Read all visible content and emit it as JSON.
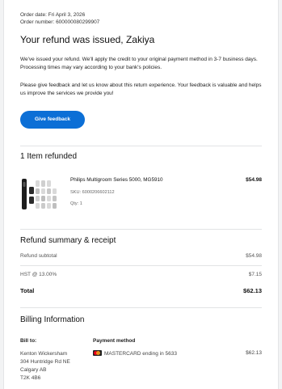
{
  "order": {
    "date_line": "Order date: Fri April 3, 2026",
    "number_line": "Order number: 600000080299907"
  },
  "title": "Your refund was issued, Zakiya",
  "message": {
    "p1": "We've issued your refund. We'll apply the credit to your original payment method in 3-7 business days. Processing times may vary according to your bank's policies.",
    "p2": "Please give feedback and let us know about this return experience. Your feedback is valuable and helps us improve the services we provide you!"
  },
  "feedback_button": "Give feedback",
  "items_section": {
    "title": "1 Item refunded",
    "items": [
      {
        "name": "Philips Multigroom Series 5000, MG5910",
        "price": "$54.98",
        "sku": "SKU: 6000206602112",
        "qty": "Qty: 1",
        "image_icon": "trimmer-kit-icon"
      }
    ]
  },
  "summary": {
    "title": "Refund summary & receipt",
    "subtotal_label": "Refund subtotal",
    "subtotal_value": "$54.98",
    "tax_label": "HST @ 13.00%",
    "tax_value": "$7.15",
    "total_label": "Total",
    "total_value": "$62.13"
  },
  "billing": {
    "title": "Billing Information",
    "bill_to_label": "Bill to:",
    "address": [
      "Kenton Wickersham",
      "304 Huntridge Rd NE",
      "Calgary AB",
      "T2K 4B6"
    ],
    "payment_label": "Payment method",
    "card_text": "MASTERCARD ending in 5633",
    "card_icon": "mastercard-icon",
    "card_amount": "$62.13"
  },
  "colors": {
    "button": "#0c6fd6",
    "accent": "#f5a623"
  }
}
